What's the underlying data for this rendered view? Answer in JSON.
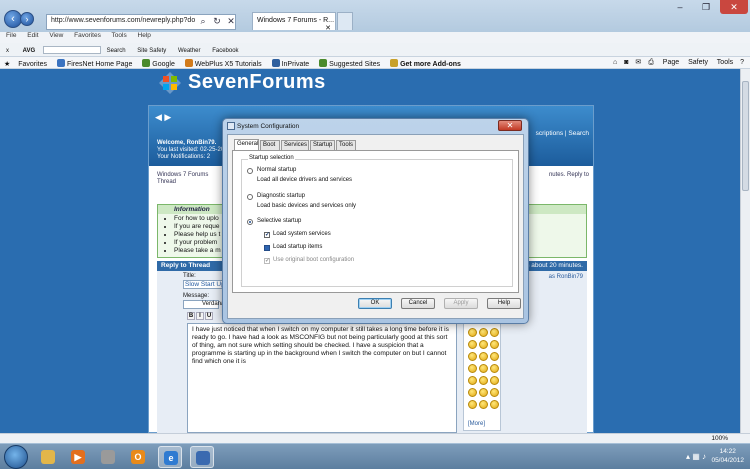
{
  "browser": {
    "url": "http://www.sevenforums.com/newreply.php?do",
    "tab_title": "Windows 7 Forums - R...",
    "menu": [
      "File",
      "Edit",
      "View",
      "Favorites",
      "Tools",
      "Help"
    ],
    "command_bar": [
      "x",
      "AVG",
      "Search",
      "Site Safety",
      "Weather",
      "Facebook"
    ],
    "favorites_label": "Favorites",
    "favorites": [
      {
        "label": "FiresNet Home Page",
        "color": "#3a73c0"
      },
      {
        "label": "Google",
        "color": "#4a8a2c"
      },
      {
        "label": "WebPlus X5 Tutorials",
        "color": "#d27b1b"
      },
      {
        "label": "InPrivate",
        "color": "#2e5f9e"
      },
      {
        "label": "Suggested Sites",
        "color": "#4a8a2c"
      },
      {
        "label": "Get more Add-ons",
        "color": "#c8a12a"
      }
    ],
    "tools": [
      "Page",
      "Safety",
      "Tools"
    ],
    "zoom": "100%"
  },
  "site": {
    "logo": "SevenForums",
    "welcome": [
      "Welcome, RonBin79.",
      "You last visited: 02-25-20...",
      "Your Notifications: 2"
    ],
    "header_links": "scriptions | Search",
    "breadcrumb": [
      "Windows 7 Forums",
      "Thread"
    ],
    "breadcrumb_right": [
      "nutes. Reply to",
      ""
    ],
    "info_title": "Information",
    "info_items": [
      "For how to uplo",
      "If you are reque",
      "Please help us t",
      "If your problem",
      "Please take a m"
    ],
    "reply_label": "Reply to Thread",
    "reply_right": "es about 20 minutes.",
    "title_label": "Title:",
    "title_value": "Slow Start Up",
    "posted_by": "as RonBin79",
    "message_label": "Message:",
    "font_name": "Verdana",
    "format_buttons": [
      "B",
      "I",
      "U"
    ],
    "message": "I have just noticed that when I switch on my computer it still takes a long time before it is ready to go. I have had a look as MSCONFIG but not being particularly good at this sort of thing, am not sure which setting should be checked. I have a suspicion that a programme is starting up in the background when I switch the computer on but I cannot find which one it is",
    "more_smilies": "[More]"
  },
  "dialog": {
    "title": "System Configuration",
    "tabs": [
      "General",
      "Boot",
      "Services",
      "Startup",
      "Tools"
    ],
    "active_tab": "General",
    "group_label": "Startup selection",
    "options": [
      {
        "label": "Normal startup",
        "desc": "Load all device drivers and services",
        "selected": false
      },
      {
        "label": "Diagnostic startup",
        "desc": "Load basic devices and services only",
        "selected": false
      },
      {
        "label": "Selective startup",
        "desc": "",
        "selected": true
      }
    ],
    "checks": [
      {
        "label": "Load system services",
        "state": "checked"
      },
      {
        "label": "Load startup items",
        "state": "indeterminate"
      },
      {
        "label": "Use original boot configuration",
        "state": "disabled"
      }
    ],
    "buttons": {
      "ok": "OK",
      "cancel": "Cancel",
      "apply": "Apply",
      "help": "Help"
    }
  },
  "taskbar": {
    "time": "14:22",
    "date": "05/04/2012",
    "apps": [
      {
        "icon": "explorer-icon",
        "color": "#e2b64a"
      },
      {
        "icon": "media-player-icon",
        "color": "#e36f1e"
      },
      {
        "icon": "scanner-icon",
        "color": "#9a9a9a"
      },
      {
        "icon": "outlook-icon",
        "color": "#e88a1a"
      },
      {
        "icon": "ie-icon",
        "color": "#2f7bd1"
      },
      {
        "icon": "msconfig-icon",
        "color": "#3a6ab0"
      }
    ]
  }
}
